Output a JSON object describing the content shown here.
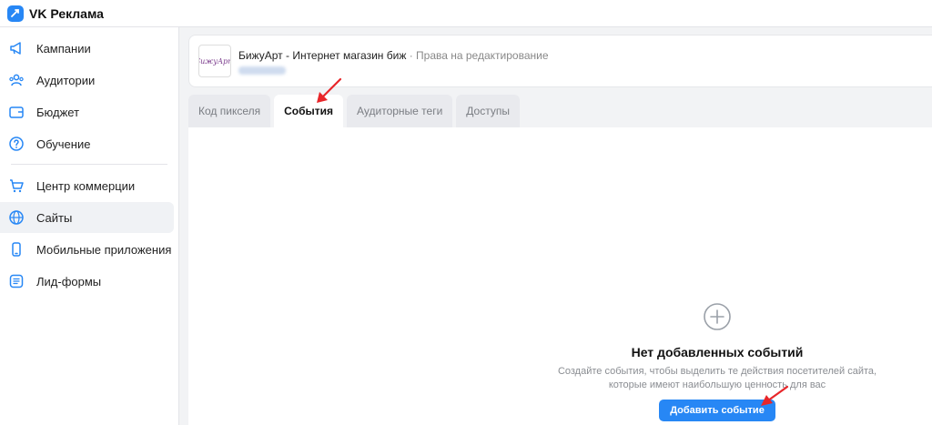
{
  "app": {
    "brand": "VK Реклама"
  },
  "sidebar": {
    "group1": [
      {
        "label": "Кампании",
        "icon": "megaphone-icon"
      },
      {
        "label": "Аудитории",
        "icon": "users-icon"
      },
      {
        "label": "Бюджет",
        "icon": "wallet-icon"
      },
      {
        "label": "Обучение",
        "icon": "question-icon"
      }
    ],
    "group2": [
      {
        "label": "Центр коммерции",
        "icon": "cart-icon"
      },
      {
        "label": "Сайты",
        "icon": "globe-icon",
        "active": true
      },
      {
        "label": "Мобильные приложения",
        "icon": "phone-icon"
      },
      {
        "label": "Лид-формы",
        "icon": "list-icon"
      }
    ]
  },
  "site": {
    "name": "БижуАрт - Интернет магазин биж",
    "separator": " · ",
    "rights": "Права на редактирование",
    "logo_text": "БижуАрт"
  },
  "tabs": [
    {
      "label": "Код пикселя"
    },
    {
      "label": "События",
      "active": true
    },
    {
      "label": "Аудиторные теги"
    },
    {
      "label": "Доступы"
    }
  ],
  "empty": {
    "title": "Нет добавленных событий",
    "desc_line1": "Создайте события, чтобы выделить те действия посетителей сайта,",
    "desc_line2": "которые имеют наибольшую ценность для вас",
    "button": "Добавить событие"
  },
  "colors": {
    "accent": "#2787f5",
    "arrow": "#e8262a"
  }
}
